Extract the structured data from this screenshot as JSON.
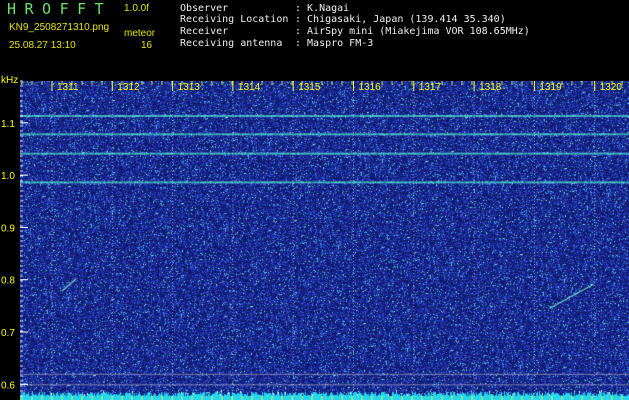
{
  "header": {
    "logo": "HROFFT",
    "version": "1.0.0f",
    "filename": "KN9_2508271310.png",
    "datetime": "25.08.27 13:10",
    "mode": "meteor",
    "count": "16"
  },
  "info": [
    {
      "label": "Observer",
      "value": ": K.Nagai"
    },
    {
      "label": "Receiving Location",
      "value": ": Chigasaki, Japan (139.414 35.340)"
    },
    {
      "label": "Receiver",
      "value": ": AirSpy mini (Miakejima VOR 108.65MHz)"
    },
    {
      "label": "Receiving antenna",
      "value": ": Maspro FM-3"
    }
  ],
  "axis": {
    "unit": "kHz",
    "y_ticks": [
      "1.1",
      "1.0",
      "0.9",
      "0.8",
      "0.7",
      "0.6"
    ],
    "y_values": [
      1.1,
      1.0,
      0.9,
      0.8,
      0.7,
      0.6
    ],
    "y_range_khz": [
      0.57,
      1.18
    ],
    "time_ticks": [
      "1311",
      "1312",
      "1313",
      "1314",
      "1315",
      "1316",
      "1317",
      "1318",
      "1319",
      "1320"
    ]
  },
  "spectrogram": {
    "carrier_lines_khz": [
      1.115,
      1.08,
      1.043,
      0.988
    ],
    "faint_lines_khz": [
      0.62,
      0.6
    ],
    "meteor_echoes": [
      {
        "minute": "1311",
        "freq_khz": 0.79
      },
      {
        "minute": "1320",
        "freq_khz": 0.78
      }
    ],
    "colors": {
      "background": "#101a6e",
      "noise": "#3d62e0",
      "noise_bright": "#5ad6e6",
      "carrier": "#4fd8d0",
      "bottom_band": "#25d8f0",
      "tick": "#ffff00",
      "grid": "#ffffff"
    }
  }
}
